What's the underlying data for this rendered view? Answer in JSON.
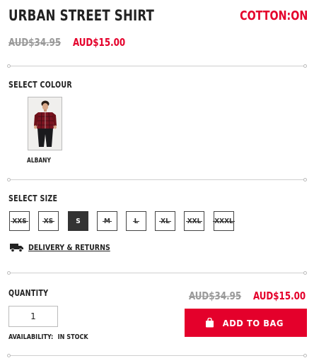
{
  "product": {
    "title": "URBAN STREET SHIRT",
    "brand": "COTTON:ON",
    "price_original": "AUD$34.95",
    "price_sale": "AUD$15.00"
  },
  "colour": {
    "heading": "SELECT COLOUR",
    "options": [
      {
        "name": "ALBANY",
        "selected": true
      }
    ]
  },
  "size": {
    "heading": "SELECT SIZE",
    "options": [
      {
        "label": "XXS",
        "available": false,
        "selected": false
      },
      {
        "label": "XS",
        "available": false,
        "selected": false
      },
      {
        "label": "S",
        "available": true,
        "selected": true
      },
      {
        "label": "M",
        "available": false,
        "selected": false
      },
      {
        "label": "L",
        "available": false,
        "selected": false
      },
      {
        "label": "XL",
        "available": false,
        "selected": false
      },
      {
        "label": "XXL",
        "available": false,
        "selected": false
      },
      {
        "label": "XXXL",
        "available": false,
        "selected": false
      }
    ]
  },
  "delivery": {
    "label": "DELIVERY & RETURNS",
    "icon": "truck-icon"
  },
  "quantity": {
    "label": "QUANTITY",
    "value": "1",
    "availability_label": "AVAILABILITY:",
    "availability_value": "IN STOCK"
  },
  "cart": {
    "price_original": "AUD$34.95",
    "price_sale": "AUD$15.00",
    "add_label": "ADD TO BAG",
    "icon": "shopping-bag-icon"
  },
  "colors": {
    "accent": "#e4002b",
    "muted": "#9a9a9a",
    "dark": "#333333"
  }
}
